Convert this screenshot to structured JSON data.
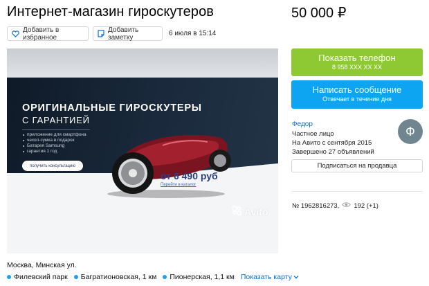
{
  "listing": {
    "title": "Интернет-магазин гироскутеров",
    "price": "50 000 ₽",
    "add_favorite_label": "Добавить в избранное",
    "add_note_label": "Добавить заметку",
    "date": "6 июля в 15:14"
  },
  "banner": {
    "headline": "ОРИГИНАЛЬНЫЕ ГИРОСКУТЕРЫ",
    "subheadline": "С ГАРАНТИЕЙ",
    "features": [
      "приложение для смартфона",
      "чехол-сумка в подарок",
      "Батарея Samsung",
      "гарантия 1 год"
    ],
    "consult_button": "получить консультацию",
    "price_text": "от 6 490 руб",
    "catalog_link": "Перейти в каталог",
    "watermark": "Avito"
  },
  "contact": {
    "phone_button": "Показать телефон",
    "phone_number": "8 958 XXX XX XX",
    "message_button": "Написать сообщение",
    "message_sub": "Отвечает в течение дня"
  },
  "seller": {
    "name": "Федор",
    "type": "Частное лицо",
    "since": "На Авито с сентября 2015",
    "completed": "Завершено 27 объявлений",
    "avatar_letter": "Ф",
    "subscribe_button": "Подписаться на продавца"
  },
  "meta": {
    "ad_number": "№ 1962816273,",
    "views": "192 (+1)"
  },
  "location": {
    "address": "Москва, Минская ул.",
    "metro": [
      {
        "name": "Филевский парк",
        "distance": ""
      },
      {
        "name": "Багратионовская, 1 км",
        "distance": ""
      },
      {
        "name": "Пионерская, 1,1 км",
        "distance": ""
      }
    ],
    "map_link": "Показать карту"
  },
  "colors": {
    "green_button": "#8ec832",
    "blue_button": "#0da5f1",
    "link": "#0a6fd6",
    "metro_dot": "#1fa0ea",
    "avatar": "#6f8691"
  }
}
